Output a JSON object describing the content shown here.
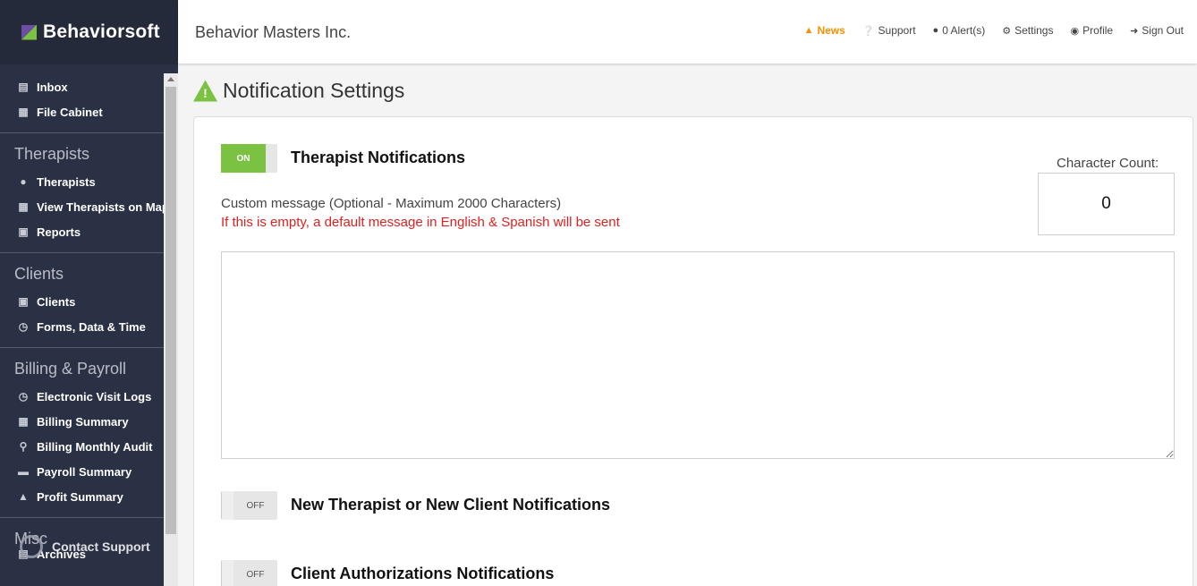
{
  "brand": {
    "name": "Behaviorsoft"
  },
  "header": {
    "company": "Behavior Masters Inc.",
    "links": {
      "news": "News",
      "support": "Support",
      "alerts": "0 Alert(s)",
      "settings": "Settings",
      "profile": "Profile",
      "signout": "Sign Out"
    }
  },
  "sidebar": {
    "top": [
      {
        "label": "Inbox",
        "icon": "inbox-icon"
      },
      {
        "label": "File Cabinet",
        "icon": "file-cabinet-icon"
      }
    ],
    "therapists": {
      "heading": "Therapists",
      "items": [
        {
          "label": "Therapists",
          "icon": "users-icon"
        },
        {
          "label": "View Therapists on Map",
          "icon": "map-icon"
        },
        {
          "label": "Reports",
          "icon": "clipboard-icon"
        }
      ]
    },
    "clients": {
      "heading": "Clients",
      "items": [
        {
          "label": "Clients",
          "icon": "file-user-icon"
        },
        {
          "label": "Forms, Data & Time",
          "icon": "clock-icon"
        }
      ]
    },
    "billing": {
      "heading": "Billing & Payroll",
      "items": [
        {
          "label": "Electronic Visit Logs",
          "icon": "history-icon"
        },
        {
          "label": "Billing Summary",
          "icon": "table-icon"
        },
        {
          "label": "Billing Monthly Audit",
          "icon": "search-icon"
        },
        {
          "label": "Payroll Summary",
          "icon": "money-icon"
        },
        {
          "label": "Profit Summary",
          "icon": "bank-icon"
        }
      ]
    },
    "misc": {
      "heading": "Misc",
      "items": [
        {
          "label": "Archives",
          "icon": "archive-icon"
        }
      ]
    },
    "contact_support": "Contact Support"
  },
  "page": {
    "title": "Notification Settings",
    "therapist": {
      "toggle": "ON",
      "title": "Therapist Notifications",
      "custom_message": "Custom message (Optional - Maximum 2000 Characters)",
      "default_note": "If this is empty, a default message in English & Spanish will be sent",
      "char_count_label": "Character Count:",
      "char_count": "0"
    },
    "new_notifications": {
      "toggle": "OFF",
      "title": "New Therapist or New Client Notifications"
    },
    "auth_notifications": {
      "toggle": "OFF",
      "title": "Client Authorizations Notifications"
    }
  },
  "colors": {
    "accent_green": "#7cc242",
    "news_orange": "#f39200",
    "note_red": "#e02020",
    "sidebar_bg": "#2b3144"
  }
}
